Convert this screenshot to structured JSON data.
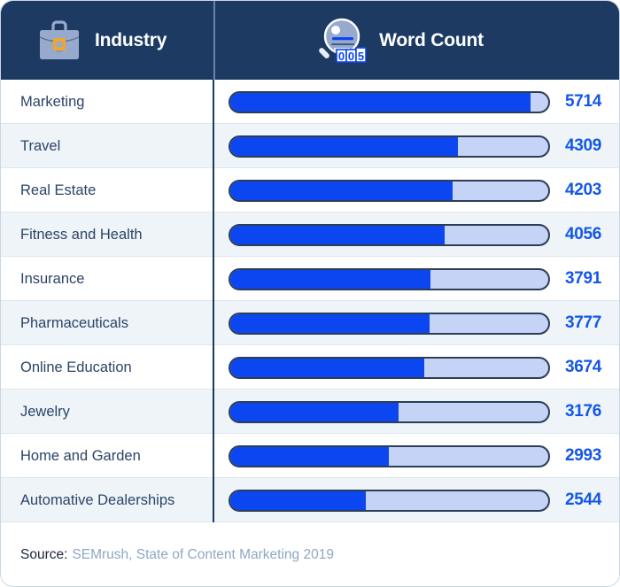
{
  "header": {
    "industry_label": "Industry",
    "wordcount_label": "Word Count",
    "industry_icon": "briefcase-icon",
    "wordcount_icon": "magnifier-word-counter-icon",
    "counter_digits": "005"
  },
  "footer": {
    "label": "Source:",
    "source": "SEMrush, State of Content Marketing 2019"
  },
  "colors": {
    "header_bg": "#1d3a63",
    "bar_fill": "#0c46f0",
    "bar_track": "#c5d3f7",
    "bar_border": "#2c3e56",
    "value_text": "#1357e8",
    "label_text": "#2b4468",
    "row_alt_bg": "#eef4f8",
    "icon_blue_gray": "#97aacd",
    "icon_accent": "#f5a623"
  },
  "chart_data": {
    "type": "bar",
    "title": "Word Count by Industry",
    "xlabel": "Word Count",
    "ylabel": "Industry",
    "orientation": "horizontal",
    "legend": [],
    "grid": false,
    "xlim": [
      530,
      6300
    ],
    "categories": [
      "Marketing",
      "Travel",
      "Real Estate",
      "Fitness and Health",
      "Insurance",
      "Pharmaceuticals",
      "Online Education",
      "Jewelry",
      "Home and Garden",
      "Automative Dealerships"
    ],
    "values": [
      5714,
      4309,
      4203,
      4056,
      3791,
      3777,
      3674,
      3176,
      2993,
      2544
    ],
    "bar_fill_percent": [
      94.5,
      71.5,
      69.8,
      67.4,
      63.0,
      62.8,
      61.1,
      52.9,
      49.9,
      42.7
    ],
    "source": "SEMrush, State of Content Marketing 2019"
  },
  "rows": [
    {
      "label": "Marketing",
      "value": "5714",
      "pct": 94.5
    },
    {
      "label": "Travel",
      "value": "4309",
      "pct": 71.5
    },
    {
      "label": "Real Estate",
      "value": "4203",
      "pct": 69.8
    },
    {
      "label": "Fitness and Health",
      "value": "4056",
      "pct": 67.4
    },
    {
      "label": "Insurance",
      "value": "3791",
      "pct": 63.0
    },
    {
      "label": "Pharmaceuticals",
      "value": "3777",
      "pct": 62.8
    },
    {
      "label": "Online Education",
      "value": "3674",
      "pct": 61.1
    },
    {
      "label": "Jewelry",
      "value": "3176",
      "pct": 52.9
    },
    {
      "label": "Home and Garden",
      "value": "2993",
      "pct": 49.9
    },
    {
      "label": "Automative Dealerships",
      "value": "2544",
      "pct": 42.7
    }
  ]
}
